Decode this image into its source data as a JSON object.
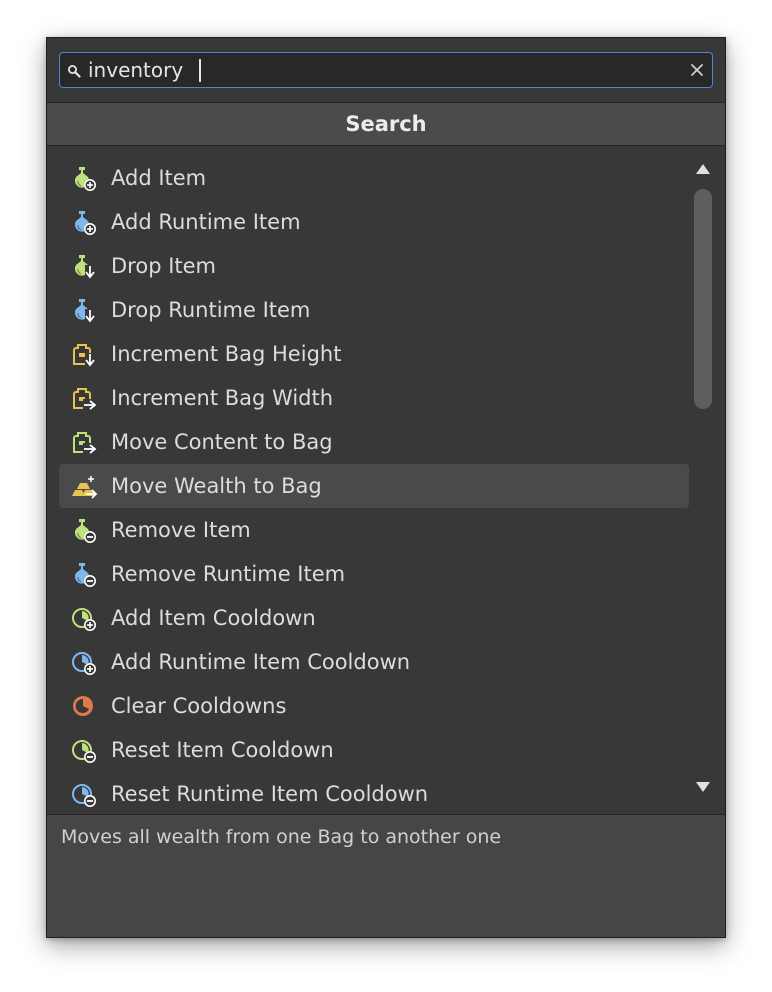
{
  "search": {
    "value": "inventory",
    "icon": "search-icon",
    "clear_icon": "close-icon"
  },
  "header": {
    "title": "Search"
  },
  "colors": {
    "accent": "#4d86d4",
    "item_green": "#bfe17a",
    "item_blue": "#7fb8ec",
    "bag_yellow": "#e8c350",
    "cooldown_orange": "#e07a4e"
  },
  "items": [
    {
      "label": "Add Item",
      "icon": "potion-add-icon",
      "color": "green",
      "selected": false
    },
    {
      "label": "Add Runtime Item",
      "icon": "potion-add-icon",
      "color": "blue",
      "selected": false
    },
    {
      "label": "Drop Item",
      "icon": "potion-drop-icon",
      "color": "green",
      "selected": false
    },
    {
      "label": "Drop Runtime Item",
      "icon": "potion-drop-icon",
      "color": "blue",
      "selected": false
    },
    {
      "label": "Increment Bag Height",
      "icon": "bag-down-icon",
      "color": "yellow",
      "selected": false
    },
    {
      "label": "Increment Bag Width",
      "icon": "bag-right-icon",
      "color": "yellow",
      "selected": false
    },
    {
      "label": "Move Content to Bag",
      "icon": "bag-right-icon",
      "color": "green",
      "selected": false
    },
    {
      "label": "Move Wealth to Bag",
      "icon": "gold-bars-icon",
      "color": "yellow",
      "selected": true
    },
    {
      "label": "Remove Item",
      "icon": "potion-remove-icon",
      "color": "green",
      "selected": false
    },
    {
      "label": "Remove Runtime Item",
      "icon": "potion-remove-icon",
      "color": "blue",
      "selected": false
    },
    {
      "label": "Add Item Cooldown",
      "icon": "cooldown-add-icon",
      "color": "green",
      "selected": false
    },
    {
      "label": "Add Runtime Item Cooldown",
      "icon": "cooldown-add-icon",
      "color": "blue",
      "selected": false
    },
    {
      "label": "Clear Cooldowns",
      "icon": "cooldown-clear-icon",
      "color": "orange",
      "selected": false
    },
    {
      "label": "Reset Item Cooldown",
      "icon": "cooldown-remove-icon",
      "color": "green",
      "selected": false
    },
    {
      "label": "Reset Runtime Item Cooldown",
      "icon": "cooldown-remove-icon",
      "color": "blue",
      "selected": false
    }
  ],
  "scrollbar": {
    "up_icon": "arrow-up-icon",
    "down_icon": "arrow-down-icon"
  },
  "footer": {
    "description": "Moves all wealth from one Bag to another one"
  }
}
